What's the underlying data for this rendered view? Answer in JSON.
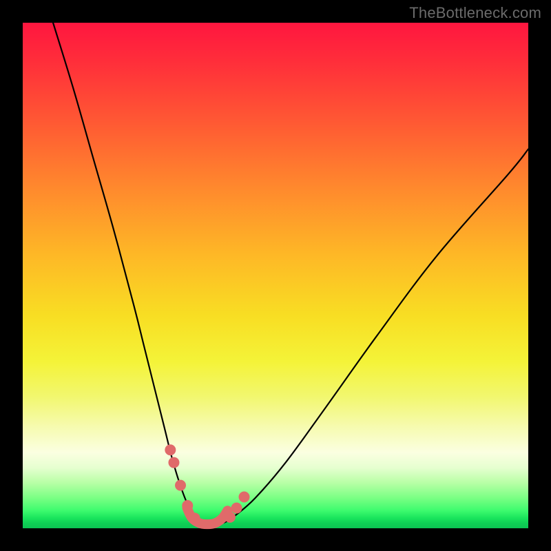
{
  "watermark": "TheBottleneck.com",
  "chart_data": {
    "type": "line",
    "title": "",
    "xlabel": "",
    "ylabel": "",
    "xlim": [
      0,
      100
    ],
    "ylim": [
      0,
      100
    ],
    "grid": false,
    "legend": false,
    "series": [
      {
        "name": "curve",
        "color": "#000000",
        "x": [
          6,
          10,
          14,
          18,
          22,
          24,
          26,
          28,
          29.5,
          31,
          32.5,
          34,
          36,
          38,
          40,
          42,
          46,
          52,
          60,
          70,
          82,
          96,
          100
        ],
        "y": [
          100,
          87,
          73,
          59,
          44,
          36,
          28,
          20,
          14,
          9,
          5,
          2.5,
          1.2,
          0.8,
          1.2,
          2.5,
          6,
          13,
          24,
          38,
          54,
          70,
          75
        ]
      },
      {
        "name": "markers-left",
        "type": "scatter",
        "color": "#e06a6a",
        "x": [
          29.2,
          29.9,
          31.2,
          32.6,
          34.0
        ],
        "y": [
          15.5,
          13.0,
          8.5,
          4.5,
          2.0
        ]
      },
      {
        "name": "markers-right",
        "type": "scatter",
        "color": "#e06a6a",
        "x": [
          41.0,
          42.3,
          43.8
        ],
        "y": [
          2.2,
          4.0,
          6.2
        ]
      },
      {
        "name": "valley-band",
        "type": "line",
        "color": "#e06a6a",
        "stroke_width": 14,
        "x": [
          32.5,
          33.5,
          35.0,
          36.5,
          38.0,
          39.5,
          40.5
        ],
        "y": [
          4.0,
          2.0,
          1.0,
          0.8,
          1.0,
          2.0,
          3.5
        ]
      }
    ]
  }
}
